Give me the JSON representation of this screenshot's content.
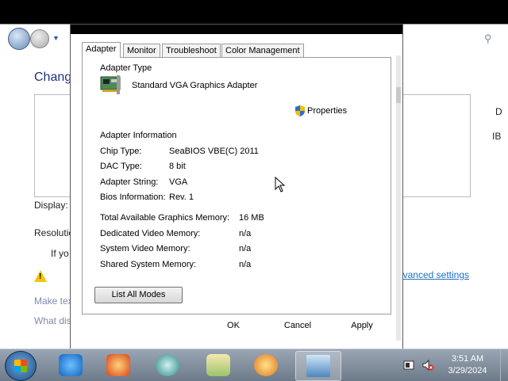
{
  "background_window": {
    "heading": "Chang",
    "display_label": "Display:",
    "resolution_label": "Resolutio",
    "warning_text": "If yo",
    "link_make_text": "Make tex",
    "link_what_display": "What dis",
    "advanced_settings_link": "Advanced settings",
    "right_letter_d": "D",
    "right_letters_ib": "IB"
  },
  "dialog": {
    "tabs": [
      {
        "label": "Adapter",
        "active": true
      },
      {
        "label": "Monitor",
        "active": false
      },
      {
        "label": "Troubleshoot",
        "active": false
      },
      {
        "label": "Color Management",
        "active": false
      }
    ],
    "adapter_type_label": "Adapter Type",
    "adapter_name": "Standard VGA Graphics Adapter",
    "properties_button": "Properties",
    "adapter_info_label": "Adapter Information",
    "info": {
      "chip_type_label": "Chip Type:",
      "chip_type_value": "SeaBIOS VBE(C) 2011",
      "dac_type_label": "DAC Type:",
      "dac_type_value": "8 bit",
      "adapter_string_label": "Adapter String:",
      "adapter_string_value": "VGA",
      "bios_info_label": "Bios Information:",
      "bios_info_value": "Rev. 1"
    },
    "memory": {
      "total_label": "Total Available Graphics Memory:",
      "total_value": "16 MB",
      "dedicated_label": "Dedicated Video Memory:",
      "dedicated_value": "n/a",
      "system_label": "System Video Memory:",
      "system_value": "n/a",
      "shared_label": "Shared System Memory:",
      "shared_value": "n/a"
    },
    "list_all_modes_button": "List All Modes",
    "ok_button": "OK",
    "cancel_button": "Cancel",
    "apply_button": "Apply"
  },
  "taskbar": {
    "pinned": [
      "internet-explorer-icon",
      "media-player-icon",
      "network-icon",
      "control-panel-icon",
      "media-center-icon",
      "display-settings-icon"
    ],
    "clock_time": "3:51 AM",
    "clock_date": "3/29/2024"
  }
}
